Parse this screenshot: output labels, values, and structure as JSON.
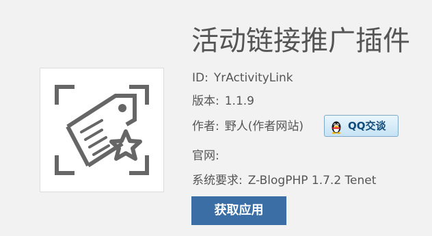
{
  "plugin": {
    "title": "活动链接推广插件",
    "icon": "tag-star-icon",
    "id_label": "ID:",
    "id_value": "YrActivityLink",
    "version_label": "版本:",
    "version_value": "1.1.9",
    "author_label": "作者:",
    "author_value": "野人(作者网站)",
    "website_label": "官网:",
    "website_value": "",
    "requirement_label": "系统要求:",
    "requirement_value": "Z-BlogPHP 1.7.2 Tenet"
  },
  "qq_button": {
    "label": "QQ交谈",
    "icon": "qq-penguin-icon"
  },
  "get_button": {
    "label": "获取应用",
    "color": "#3a6ea5"
  },
  "colors": {
    "background": "#f2f2f2",
    "text": "#555555",
    "icon": "#666666"
  }
}
